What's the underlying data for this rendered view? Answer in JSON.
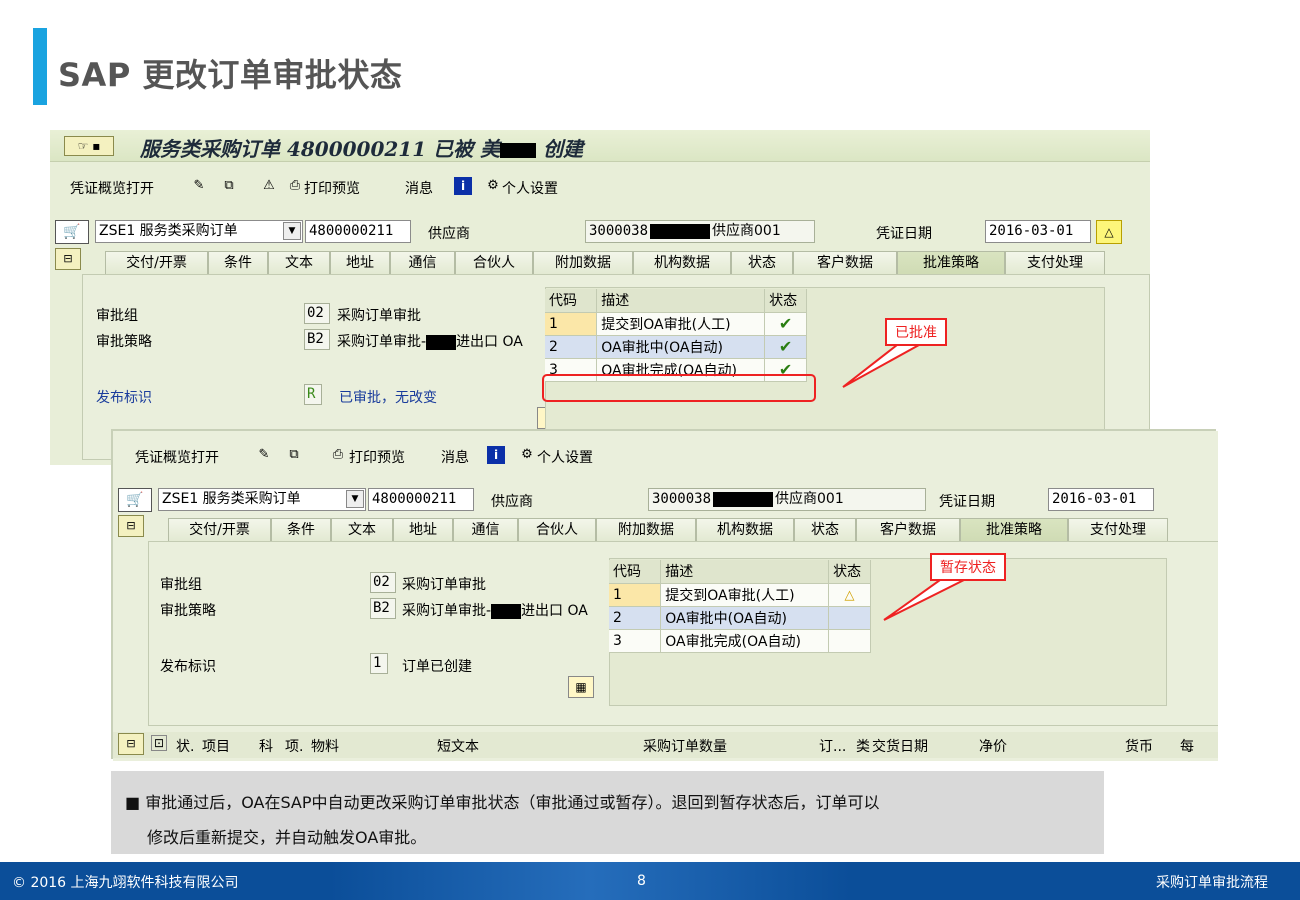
{
  "slide": {
    "title": "SAP 更改订单审批状态",
    "note_line1": "■ 审批通过后，OA在SAP中自动更改采购订单审批状态（审批通过或暂存）。退回到暂存状态后，订单可以",
    "note_line2": "修改后重新提交，并自动触发OA审批。"
  },
  "window1": {
    "title_prefix": "服务类采购订单 4800000211 已被 ",
    "title_visible_char": "美",
    "title_suffix": " 创建"
  },
  "toolbar": {
    "doc_overview": "凭证概览打开",
    "print_preview": "打印预览",
    "messages": "消息",
    "personal_settings": "个人设置"
  },
  "header": {
    "doc_type": "ZSE1 服务类采购订单",
    "po_number": "4800000211",
    "vendor_label": "供应商",
    "vendor_id": "3000038",
    "vendor_name": "供应商001",
    "doc_date_label": "凭证日期",
    "doc_date": "2016-03-01"
  },
  "tabs": [
    "交付/开票",
    "条件",
    "文本",
    "地址",
    "通信",
    "合伙人",
    "附加数据",
    "机构数据",
    "状态",
    "客户数据",
    "批准策略",
    "支付处理"
  ],
  "approval": {
    "group_label": "审批组",
    "group_code": "02",
    "group_name": "采购订单审批",
    "strategy_label": "审批策略",
    "strategy_code": "B2",
    "strategy_name_prefix": "采购订单审批-",
    "strategy_name_suffix": "进出口 OA",
    "release_label": "发布标识",
    "table_headers": [
      "代码",
      "描述",
      "状态"
    ],
    "rows": [
      {
        "code": "1",
        "desc": "提交到OA审批(人工)"
      },
      {
        "code": "2",
        "desc": "OA审批中(OA自动)"
      },
      {
        "code": "3",
        "desc": "OA审批完成(OA自动)"
      }
    ]
  },
  "window1_release": {
    "indicator": "R",
    "text": "已审批，无改变",
    "callout": "已批准",
    "statuses": [
      "✔",
      "✔",
      "✔"
    ]
  },
  "window2_release": {
    "indicator": "1",
    "text": "订单已创建",
    "callout": "暂存状态",
    "statuses": [
      "△",
      "",
      ""
    ]
  },
  "item_columns": [
    "状.",
    "项目",
    "科",
    "项.",
    "物料",
    "短文本",
    "采购订单数量",
    "订...",
    "类",
    "交货日期",
    "净价",
    "货币",
    "每"
  ],
  "footer": {
    "copyright": "© 2016 上海九翊软件科技有限公司",
    "page": "8",
    "section": "采购订单审批流程"
  },
  "colors": {
    "accent": "#1aa3e0",
    "footer": "#0b4e99",
    "callout_red": "#e22222",
    "sap_bg": "#e8eed8"
  },
  "icons": [
    "cart-icon",
    "expand-icon",
    "info-icon",
    "glasses-icon",
    "print-icon",
    "check-icon",
    "warning-triangle-icon"
  ]
}
